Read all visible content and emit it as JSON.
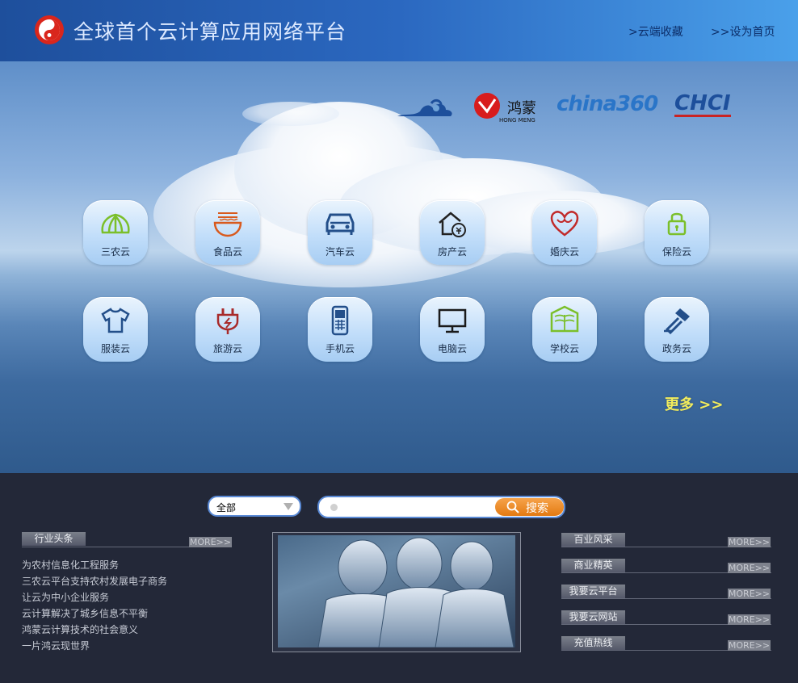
{
  "header": {
    "title": "全球首个云计算应用网络平台",
    "bookmark_link": ">云端收藏",
    "homepage_link": ">>设为首页"
  },
  "partners": {
    "hongmeng_text": "HONG MENG",
    "china360_text": "china360",
    "chci_text": "CHCI"
  },
  "apps": [
    {
      "label": "三农云",
      "icon": "leaf-icon"
    },
    {
      "label": "食品云",
      "icon": "noodle-bowl-icon"
    },
    {
      "label": "汽车云",
      "icon": "car-icon"
    },
    {
      "label": "房产云",
      "icon": "house-icon"
    },
    {
      "label": "婚庆云",
      "icon": "heart-icon"
    },
    {
      "label": "保险云",
      "icon": "lock-icon"
    },
    {
      "label": "服装云",
      "icon": "shirt-icon"
    },
    {
      "label": "旅游云",
      "icon": "plug-icon"
    },
    {
      "label": "手机云",
      "icon": "mobile-phone-icon"
    },
    {
      "label": "电脑云",
      "icon": "monitor-icon"
    },
    {
      "label": "学校云",
      "icon": "book-icon"
    },
    {
      "label": "政务云",
      "icon": "stamp-icon"
    }
  ],
  "more_link": "更多 >>",
  "search": {
    "category_value": "全部",
    "button_label": "搜索"
  },
  "industry": {
    "tab": "行业头条",
    "more": "MORE>>",
    "items": [
      "为农村信息化工程服务",
      "三农云平台支持农村发展电子商务",
      "让云为中小企业服务",
      "云计算解决了城乡信息不平衡",
      "鸿蒙云计算技术的社会意义",
      "一片鸿云现世界"
    ]
  },
  "right_tabs": [
    {
      "label": "百业风采",
      "more": "MORE>>"
    },
    {
      "label": "商业精英",
      "more": "MORE>>"
    },
    {
      "label": "我要云平台",
      "more": "MORE>>"
    },
    {
      "label": "我要云网站",
      "more": "MORE>>"
    },
    {
      "label": "充值热线",
      "more": "MORE>>"
    }
  ],
  "colors": {
    "header_start": "#1e4f9c",
    "header_end": "#4aa0ea",
    "footer_bg": "#232838",
    "search_button": "#e37a12",
    "more_link": "#f2ec5c"
  }
}
